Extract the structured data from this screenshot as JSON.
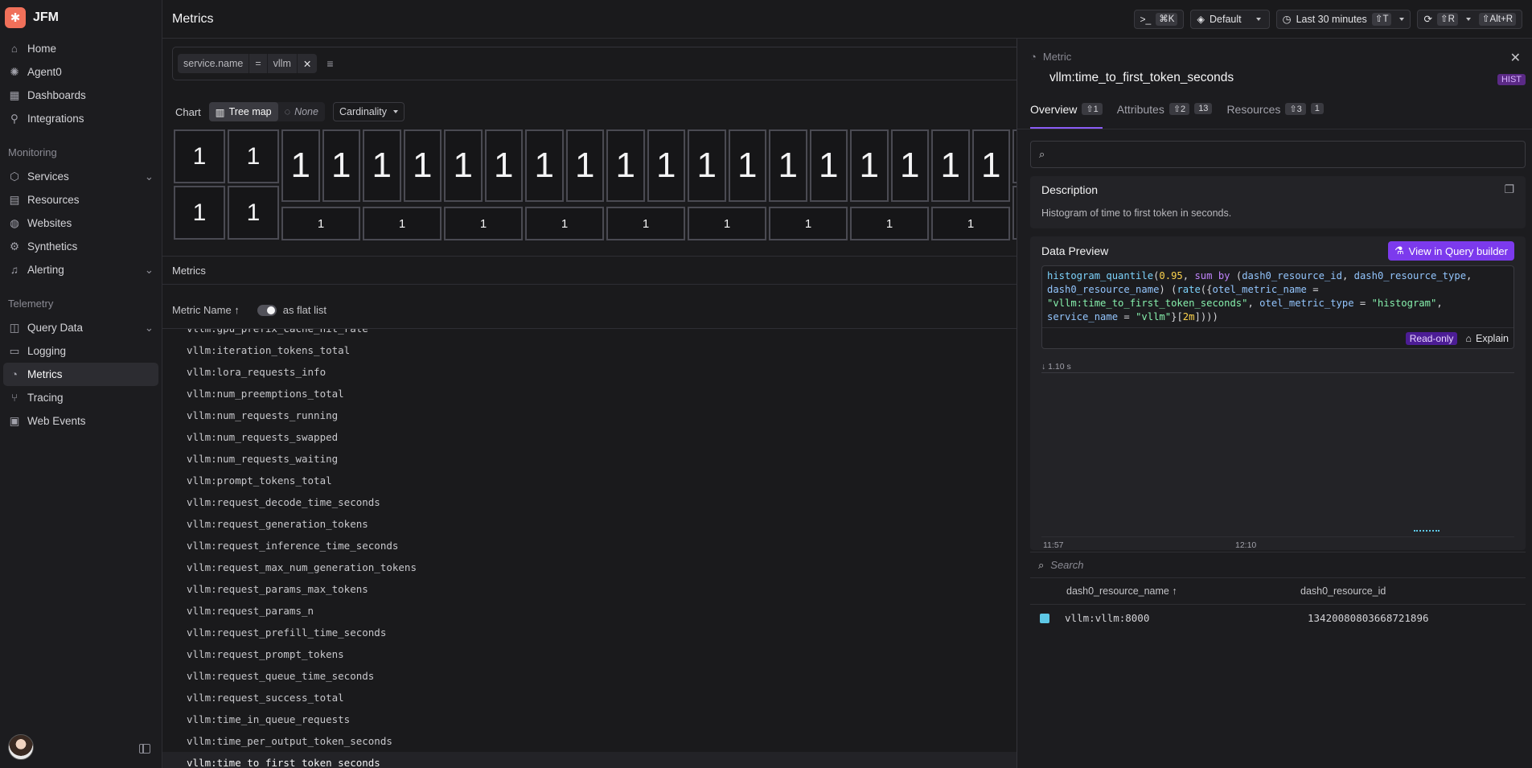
{
  "app": {
    "name": "JFM"
  },
  "sidebar": {
    "main_items": [
      {
        "label": "Home",
        "icon": "home-icon"
      },
      {
        "label": "Agent0",
        "icon": "agent-icon"
      },
      {
        "label": "Dashboards",
        "icon": "dashboards-icon"
      },
      {
        "label": "Integrations",
        "icon": "integrations-icon"
      }
    ],
    "monitoring_title": "Monitoring",
    "monitoring_items": [
      {
        "label": "Services",
        "icon": "services-icon",
        "expandable": true
      },
      {
        "label": "Resources",
        "icon": "resources-icon"
      },
      {
        "label": "Websites",
        "icon": "globe-icon"
      },
      {
        "label": "Synthetics",
        "icon": "synthetics-icon"
      },
      {
        "label": "Alerting",
        "icon": "bell-icon",
        "expandable": true
      }
    ],
    "telemetry_title": "Telemetry",
    "telemetry_items": [
      {
        "label": "Query Data",
        "icon": "query-icon",
        "expandable": true
      },
      {
        "label": "Logging",
        "icon": "logging-icon"
      },
      {
        "label": "Metrics",
        "icon": "gauge-icon",
        "active": true
      },
      {
        "label": "Tracing",
        "icon": "tracing-icon"
      },
      {
        "label": "Web Events",
        "icon": "web-events-icon"
      }
    ]
  },
  "topbar": {
    "title": "Metrics",
    "command_kbd": "⌘K",
    "dataset": "Default",
    "time_range": "Last 30 minutes",
    "time_kbd": "⇧T",
    "refresh_kbd": "⇧R",
    "refresh_alt_kbd": "⇧Alt+R"
  },
  "filter": {
    "key": "service.name",
    "op": "=",
    "value": "vllm"
  },
  "chart_controls": {
    "label": "Chart",
    "tree_map": "Tree map",
    "none": "None",
    "grouping": "Cardinality"
  },
  "treemap": {
    "values_top": [
      "1",
      "1",
      "1",
      "1",
      "1",
      "1",
      "1",
      "1",
      "1",
      "1",
      "1",
      "1",
      "1",
      "1",
      "1",
      "1",
      "1",
      "1",
      "1",
      "1",
      "1"
    ],
    "values_bottom": [
      "1",
      "1",
      "1",
      "1",
      "1",
      "1",
      "1",
      "1",
      "1",
      "1",
      "1",
      "1",
      "1"
    ]
  },
  "metrics_section": {
    "title": "Metrics",
    "column_label": "Metric Name ↑",
    "flat_list_label": "as flat list",
    "items": [
      "vllm:gpu_prefix_cache_hit_rate",
      "vllm:iteration_tokens_total",
      "vllm:lora_requests_info",
      "vllm:num_preemptions_total",
      "vllm:num_requests_running",
      "vllm:num_requests_swapped",
      "vllm:num_requests_waiting",
      "vllm:prompt_tokens_total",
      "vllm:request_decode_time_seconds",
      "vllm:request_generation_tokens",
      "vllm:request_inference_time_seconds",
      "vllm:request_max_num_generation_tokens",
      "vllm:request_params_max_tokens",
      "vllm:request_params_n",
      "vllm:request_prefill_time_seconds",
      "vllm:request_prompt_tokens",
      "vllm:request_queue_time_seconds",
      "vllm:request_success_total",
      "vllm:time_in_queue_requests",
      "vllm:time_per_output_token_seconds",
      "vllm:time_to_first_token_seconds"
    ],
    "selected": "vllm:time_to_first_token_seconds"
  },
  "panel": {
    "label": "Metric",
    "title": "vllm:time_to_first_token_seconds",
    "type_badge": "HIST",
    "tabs": [
      {
        "label": "Overview",
        "kbd": "⇧1",
        "count": ""
      },
      {
        "label": "Attributes",
        "kbd": "⇧2",
        "count": "13"
      },
      {
        "label": "Resources",
        "kbd": "⇧3",
        "count": "1"
      }
    ],
    "description_title": "Description",
    "description_text": "Histogram of time to first token in seconds.",
    "preview_title": "Data Preview",
    "query_builder_btn": "View in Query builder",
    "readonly": "Read-only",
    "explain": "Explain",
    "y_marker": "↓ 1.10 s",
    "x_ticks": [
      "11:57",
      "12:10"
    ],
    "table_search_placeholder": "Search",
    "table_columns": [
      "dash0_resource_name ↑",
      "dash0_resource_id"
    ],
    "table_rows": [
      {
        "name": "vllm:vllm:8000",
        "id": "13420080803668721896",
        "color": "#5ec8e6"
      }
    ]
  }
}
